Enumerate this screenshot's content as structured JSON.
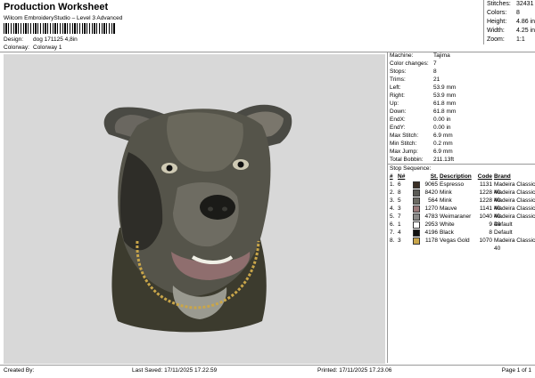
{
  "header": {
    "title": "Production Worksheet",
    "subtitle": "Wilcom EmbroideryStudio – Level 3 Advanced",
    "design_label": "Design:",
    "design_value": "dog 171125 4,8in",
    "colorway_label": "Colorway:",
    "colorway_value": "Colorway 1"
  },
  "stats": [
    {
      "label": "Stitches:",
      "value": "32431"
    },
    {
      "label": "Colors:",
      "value": "8"
    },
    {
      "label": "Height:",
      "value": "4.86 in"
    },
    {
      "label": "Width:",
      "value": "4.25 in"
    },
    {
      "label": "Zoom:",
      "value": "1:1"
    }
  ],
  "info": [
    {
      "label": "Machine:",
      "value": "Tajima"
    },
    {
      "label": "Color changes:",
      "value": "7"
    },
    {
      "label": "Stops:",
      "value": "8"
    },
    {
      "label": "Trims:",
      "value": "21"
    },
    {
      "label": "Left:",
      "value": "53.9 mm"
    },
    {
      "label": "Right:",
      "value": "53.9 mm"
    },
    {
      "label": "Up:",
      "value": "61.8 mm"
    },
    {
      "label": "Down:",
      "value": "61.8 mm"
    },
    {
      "label": "EndX:",
      "value": "0.00 in"
    },
    {
      "label": "EndY:",
      "value": "0.00 in"
    },
    {
      "label": "Max Stitch:",
      "value": "6.9 mm"
    },
    {
      "label": "Min Stitch:",
      "value": "0.2 mm"
    },
    {
      "label": "Max Jump:",
      "value": "6.9 mm"
    },
    {
      "label": "Total Bobbin:",
      "value": "211.13ft"
    }
  ],
  "stop_sequence": {
    "title": "Stop Sequence:",
    "headers": {
      "hash": "#",
      "n": "N#",
      "st": "St.",
      "desc": "Description",
      "code": "Code",
      "brand": "Brand"
    },
    "rows": [
      {
        "hash": "1.",
        "n": "6",
        "color": "#3b2f26",
        "st": "9065",
        "desc": "Espresso",
        "code": "1131",
        "brand": "Madeira Classic 40"
      },
      {
        "hash": "2.",
        "n": "8",
        "color": "#5a5a55",
        "st": "8420",
        "desc": "Mink",
        "code": "1228",
        "brand": "Madeira Classic 40"
      },
      {
        "hash": "3.",
        "n": "5",
        "color": "#6b6a62",
        "st": "564",
        "desc": "Mink",
        "code": "1228",
        "brand": "Madeira Classic 40"
      },
      {
        "hash": "4.",
        "n": "3",
        "color": "#9a7a7a",
        "st": "1270",
        "desc": "Mauve",
        "code": "1141",
        "brand": "Madeira Classic 40"
      },
      {
        "hash": "5.",
        "n": "7",
        "color": "#8a8a88",
        "st": "4783",
        "desc": "Weimaraner",
        "code": "1040",
        "brand": "Madeira Classic 40"
      },
      {
        "hash": "6.",
        "n": "1",
        "color": "#ffffff",
        "st": "2953",
        "desc": "White",
        "code": "9",
        "brand": "Default"
      },
      {
        "hash": "7.",
        "n": "4",
        "color": "#111111",
        "st": "4196",
        "desc": "Black",
        "code": "8",
        "brand": "Default"
      },
      {
        "hash": "8.",
        "n": "3",
        "color": "#c9a64a",
        "st": "1178",
        "desc": "Vegas Gold",
        "code": "1070",
        "brand": "Madeira Classic 40"
      }
    ]
  },
  "footer": {
    "created_by": "Created By:",
    "last_saved": "Last Saved: 17/11/2025 17.22.59",
    "printed": "Printed: 17/11/2025 17.23.06",
    "page": "Page 1 of 1"
  }
}
